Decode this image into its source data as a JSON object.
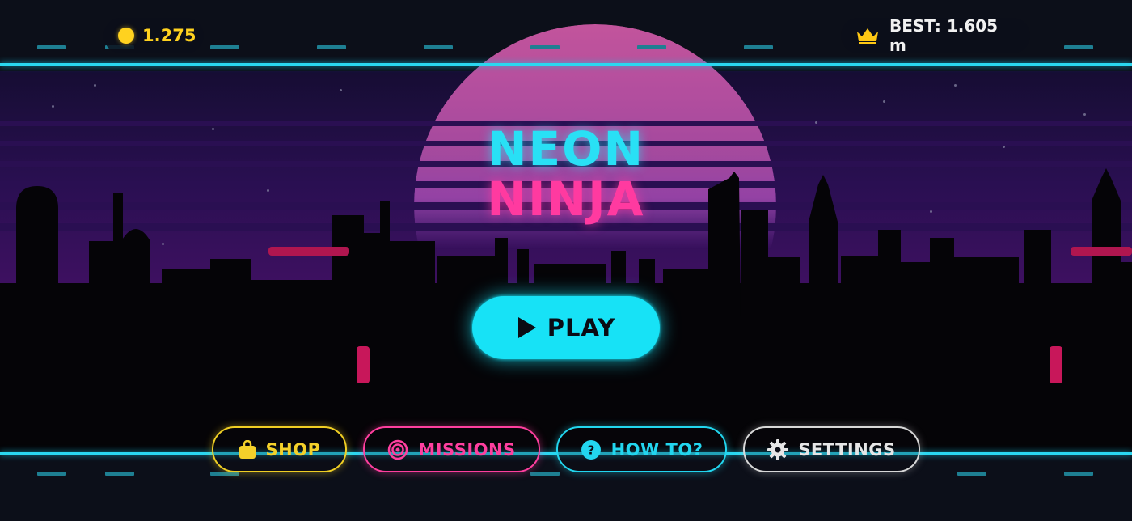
{
  "game": {
    "title_line1": "NEON",
    "title_line2": "NINJA"
  },
  "hud": {
    "coins": "1.275",
    "coin_icon": "coin-icon",
    "best_score": "BEST: 1.605 m",
    "best_icon": "crown-icon"
  },
  "play_button": {
    "label": "PLAY",
    "icon": "play-icon"
  },
  "menu": [
    {
      "label": "SHOP",
      "icon": "shopping-bag-icon",
      "color": "#f0cf24"
    },
    {
      "label": "MISSIONS",
      "icon": "target-icon",
      "color": "#ff3f9f"
    },
    {
      "label": "HOW TO?",
      "icon": "help-icon",
      "color": "#22d6ef"
    },
    {
      "label": "SETTINGS",
      "icon": "gear-icon",
      "color": "#d8d8d8"
    }
  ],
  "colors": {
    "neon_cyan": "#29e0f5",
    "neon_pink": "#ff3aa0",
    "coin_yellow": "#ffd21f"
  }
}
